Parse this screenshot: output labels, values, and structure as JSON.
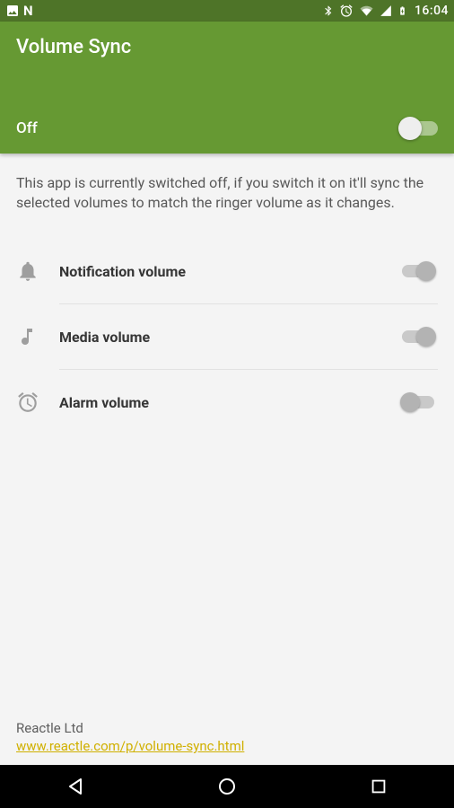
{
  "status": {
    "time": "16:04"
  },
  "header": {
    "title": "Volume Sync",
    "state_label": "Off"
  },
  "description": "This app is currently switched off, if you switch it on it'll sync the selected volumes to match the ringer volume as it changes.",
  "settings": [
    {
      "label": "Notification volume"
    },
    {
      "label": "Media volume"
    },
    {
      "label": "Alarm volume"
    }
  ],
  "footer": {
    "company": "Reactle Ltd",
    "link": "www.reactle.com/p/volume-sync.html"
  }
}
